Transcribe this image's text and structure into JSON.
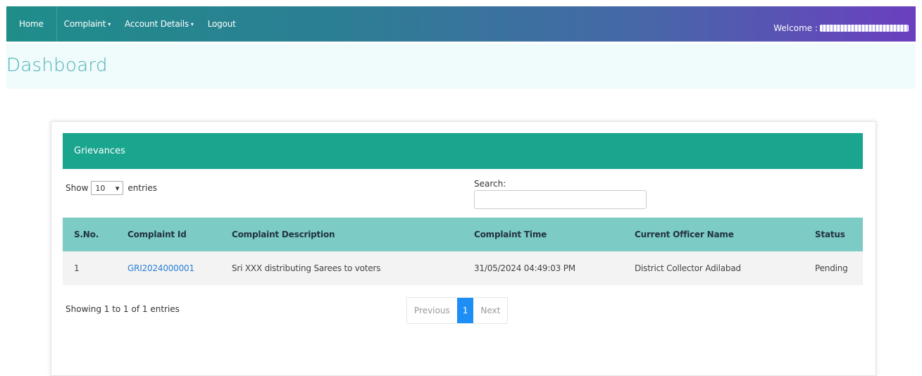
{
  "nav": {
    "home": "Home",
    "complaint": "Complaint",
    "account": "Account Details",
    "logout": "Logout",
    "welcome": "Welcome :",
    "caret": "▾"
  },
  "page": {
    "title": "Dashboard"
  },
  "panel": {
    "heading": "Grievances"
  },
  "controls": {
    "show": "Show",
    "length_value": "10",
    "entries": "entries",
    "search_label": "Search:",
    "search_value": ""
  },
  "table": {
    "headers": [
      "S.No.",
      "Complaint Id",
      "Complaint Description",
      "Complaint Time",
      "Current Officer Name",
      "Status"
    ],
    "rows": [
      [
        "1",
        "GRI2024000001",
        "Sri XXX distributing Sarees to voters",
        "31/05/2024 04:49:03 PM",
        "District Collector Adilabad",
        "Pending"
      ]
    ]
  },
  "footer": {
    "info": "Showing 1 to 1 of 1 entries",
    "previous": "Previous",
    "page": "1",
    "next": "Next"
  }
}
